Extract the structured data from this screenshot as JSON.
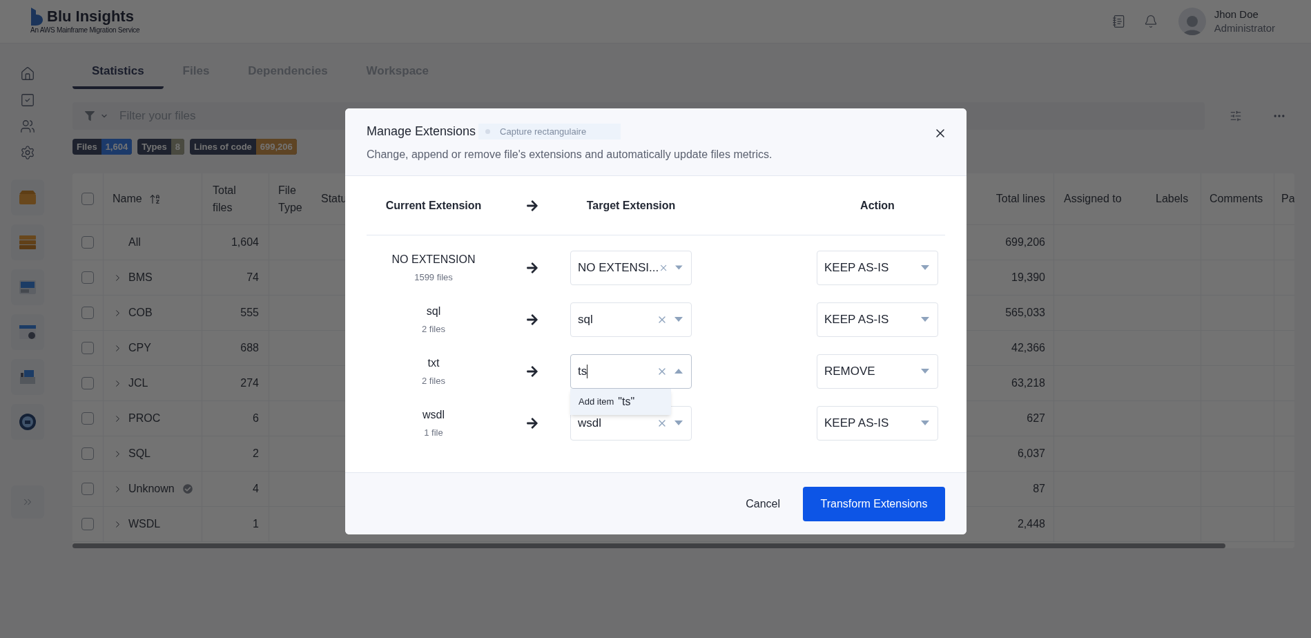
{
  "header": {
    "logo_title": "Blu Insights",
    "logo_subtitle": "An AWS Mainframe Migration Service",
    "user": {
      "name": "Jhon Doe",
      "role": "Administrator"
    }
  },
  "tabs": [
    {
      "label": "Statistics",
      "selected": true
    },
    {
      "label": "Files",
      "selected": false
    },
    {
      "label": "Dependencies",
      "selected": false
    },
    {
      "label": "Workspace",
      "selected": false
    }
  ],
  "filter": {
    "placeholder": "Filter your files"
  },
  "badges": [
    {
      "label": "Files",
      "value": "1,604",
      "color": "#1c3a6a"
    },
    {
      "label": "Types",
      "value": "8",
      "color": "#4a4a40"
    },
    {
      "label": "Lines of code",
      "value": "699,206",
      "color": "#5e4424"
    }
  ],
  "table": {
    "select_all_checked": false,
    "columns": [
      "Name",
      "Total files",
      "File Type",
      "Statu",
      "Total lines",
      "Assigned to",
      "Labels",
      "Comments",
      "Pa"
    ],
    "rows": [
      {
        "name": "All",
        "total_files": "1,604",
        "total_lines": "699,206",
        "expandable": false,
        "verified": false,
        "checked": false
      },
      {
        "name": "BMS",
        "total_files": "74",
        "total_lines": "19,390",
        "expandable": true,
        "verified": false,
        "checked": false
      },
      {
        "name": "COB",
        "total_files": "555",
        "total_lines": "565,033",
        "expandable": true,
        "verified": false,
        "checked": false
      },
      {
        "name": "CPY",
        "total_files": "688",
        "total_lines": "42,366",
        "expandable": true,
        "verified": false,
        "checked": false
      },
      {
        "name": "JCL",
        "total_files": "274",
        "total_lines": "63,218",
        "expandable": true,
        "verified": false,
        "checked": false
      },
      {
        "name": "PROC",
        "total_files": "6",
        "total_lines": "627",
        "expandable": true,
        "verified": false,
        "checked": false
      },
      {
        "name": "SQL",
        "total_files": "2",
        "total_lines": "6,037",
        "expandable": true,
        "verified": false,
        "checked": false
      },
      {
        "name": "Unknown",
        "total_files": "4",
        "total_lines": "87",
        "expandable": true,
        "verified": true,
        "checked": false
      },
      {
        "name": "WSDL",
        "total_files": "1",
        "total_lines": "2,448",
        "expandable": true,
        "verified": false,
        "checked": false
      }
    ]
  },
  "modal": {
    "title": "Manage Extensions",
    "capture_label": "Capture rectangulaire",
    "description": "Change, append or remove file's extensions and automatically update files metrics.",
    "columns": [
      "Current Extension",
      "Target Extension",
      "Action"
    ],
    "rows": [
      {
        "extension": "NO EXTENSION",
        "file_count": "1599 files",
        "target": "NO EXTENSI...",
        "expanded": false,
        "action": "KEEP AS-IS"
      },
      {
        "extension": "sql",
        "file_count": "2 files",
        "target": "sql",
        "expanded": false,
        "action": "KEEP AS-IS"
      },
      {
        "extension": "txt",
        "file_count": "2 files",
        "target": "ts",
        "expanded": true,
        "action": "REMOVE"
      },
      {
        "extension": "wsdl",
        "file_count": "1 file",
        "target": "wsdl",
        "expanded": false,
        "action": "KEEP AS-IS"
      }
    ],
    "dropdown": {
      "prefix": "Add item",
      "value": "\"ts\""
    },
    "buttons": {
      "cancel": "Cancel",
      "confirm": "Transform Extensions"
    }
  }
}
